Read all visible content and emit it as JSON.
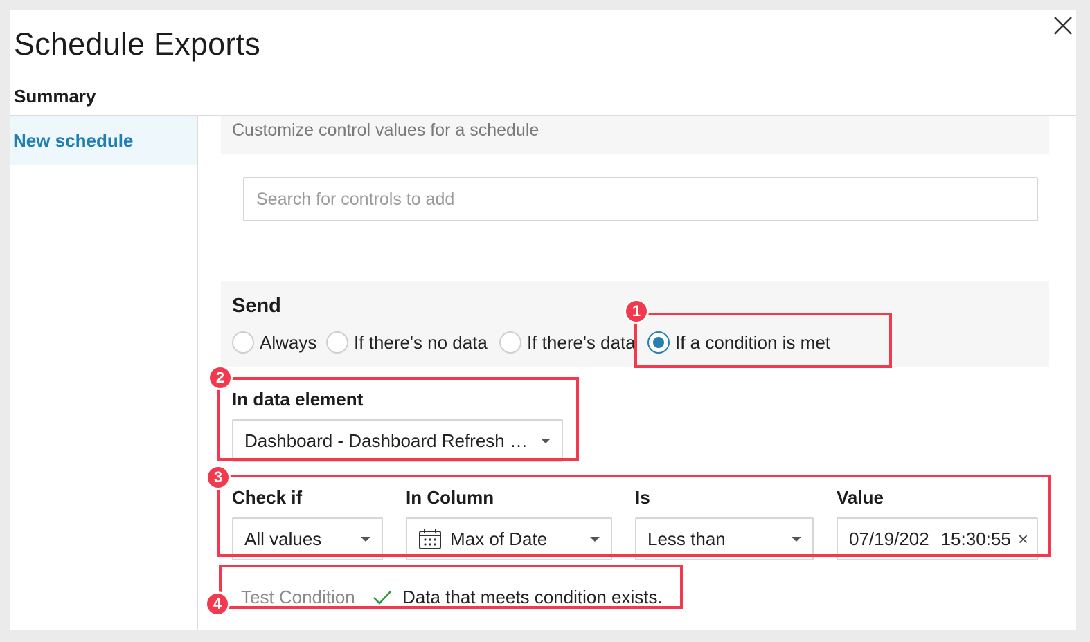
{
  "dialog": {
    "title": "Schedule Exports",
    "summary_label": "Summary"
  },
  "sidebar": {
    "items": [
      {
        "label": "New schedule",
        "selected": true
      }
    ]
  },
  "controls": {
    "header": "Customize control values for a schedule",
    "search_placeholder": "Search for controls to add"
  },
  "send": {
    "label": "Send",
    "options": [
      {
        "label": "Always",
        "checked": false
      },
      {
        "label": "If there's no data",
        "checked": false
      },
      {
        "label": "If there's data",
        "checked": false
      },
      {
        "label": "If a condition is met",
        "checked": true
      }
    ]
  },
  "condition": {
    "data_element_label": "In data element",
    "data_element_value": "Dashboard - Dashboard Refresh …",
    "check_if_label": "Check if",
    "check_if_value": "All values",
    "in_column_label": "In Column",
    "in_column_value": "Max of Date",
    "is_label": "Is",
    "is_value": "Less than",
    "value_label": "Value",
    "value_date": "07/19/202",
    "value_time": "15:30:55"
  },
  "test": {
    "label": "Test Condition",
    "result": "Data that meets condition exists."
  },
  "annotations": {
    "badge_1": "1",
    "badge_2": "2",
    "badge_3": "3",
    "badge_4": "4",
    "color": "#f2394d"
  },
  "colors": {
    "accent": "#2a7fb1",
    "sidebar_selected_bg": "#eef7fc",
    "success": "#2e9a3e"
  }
}
